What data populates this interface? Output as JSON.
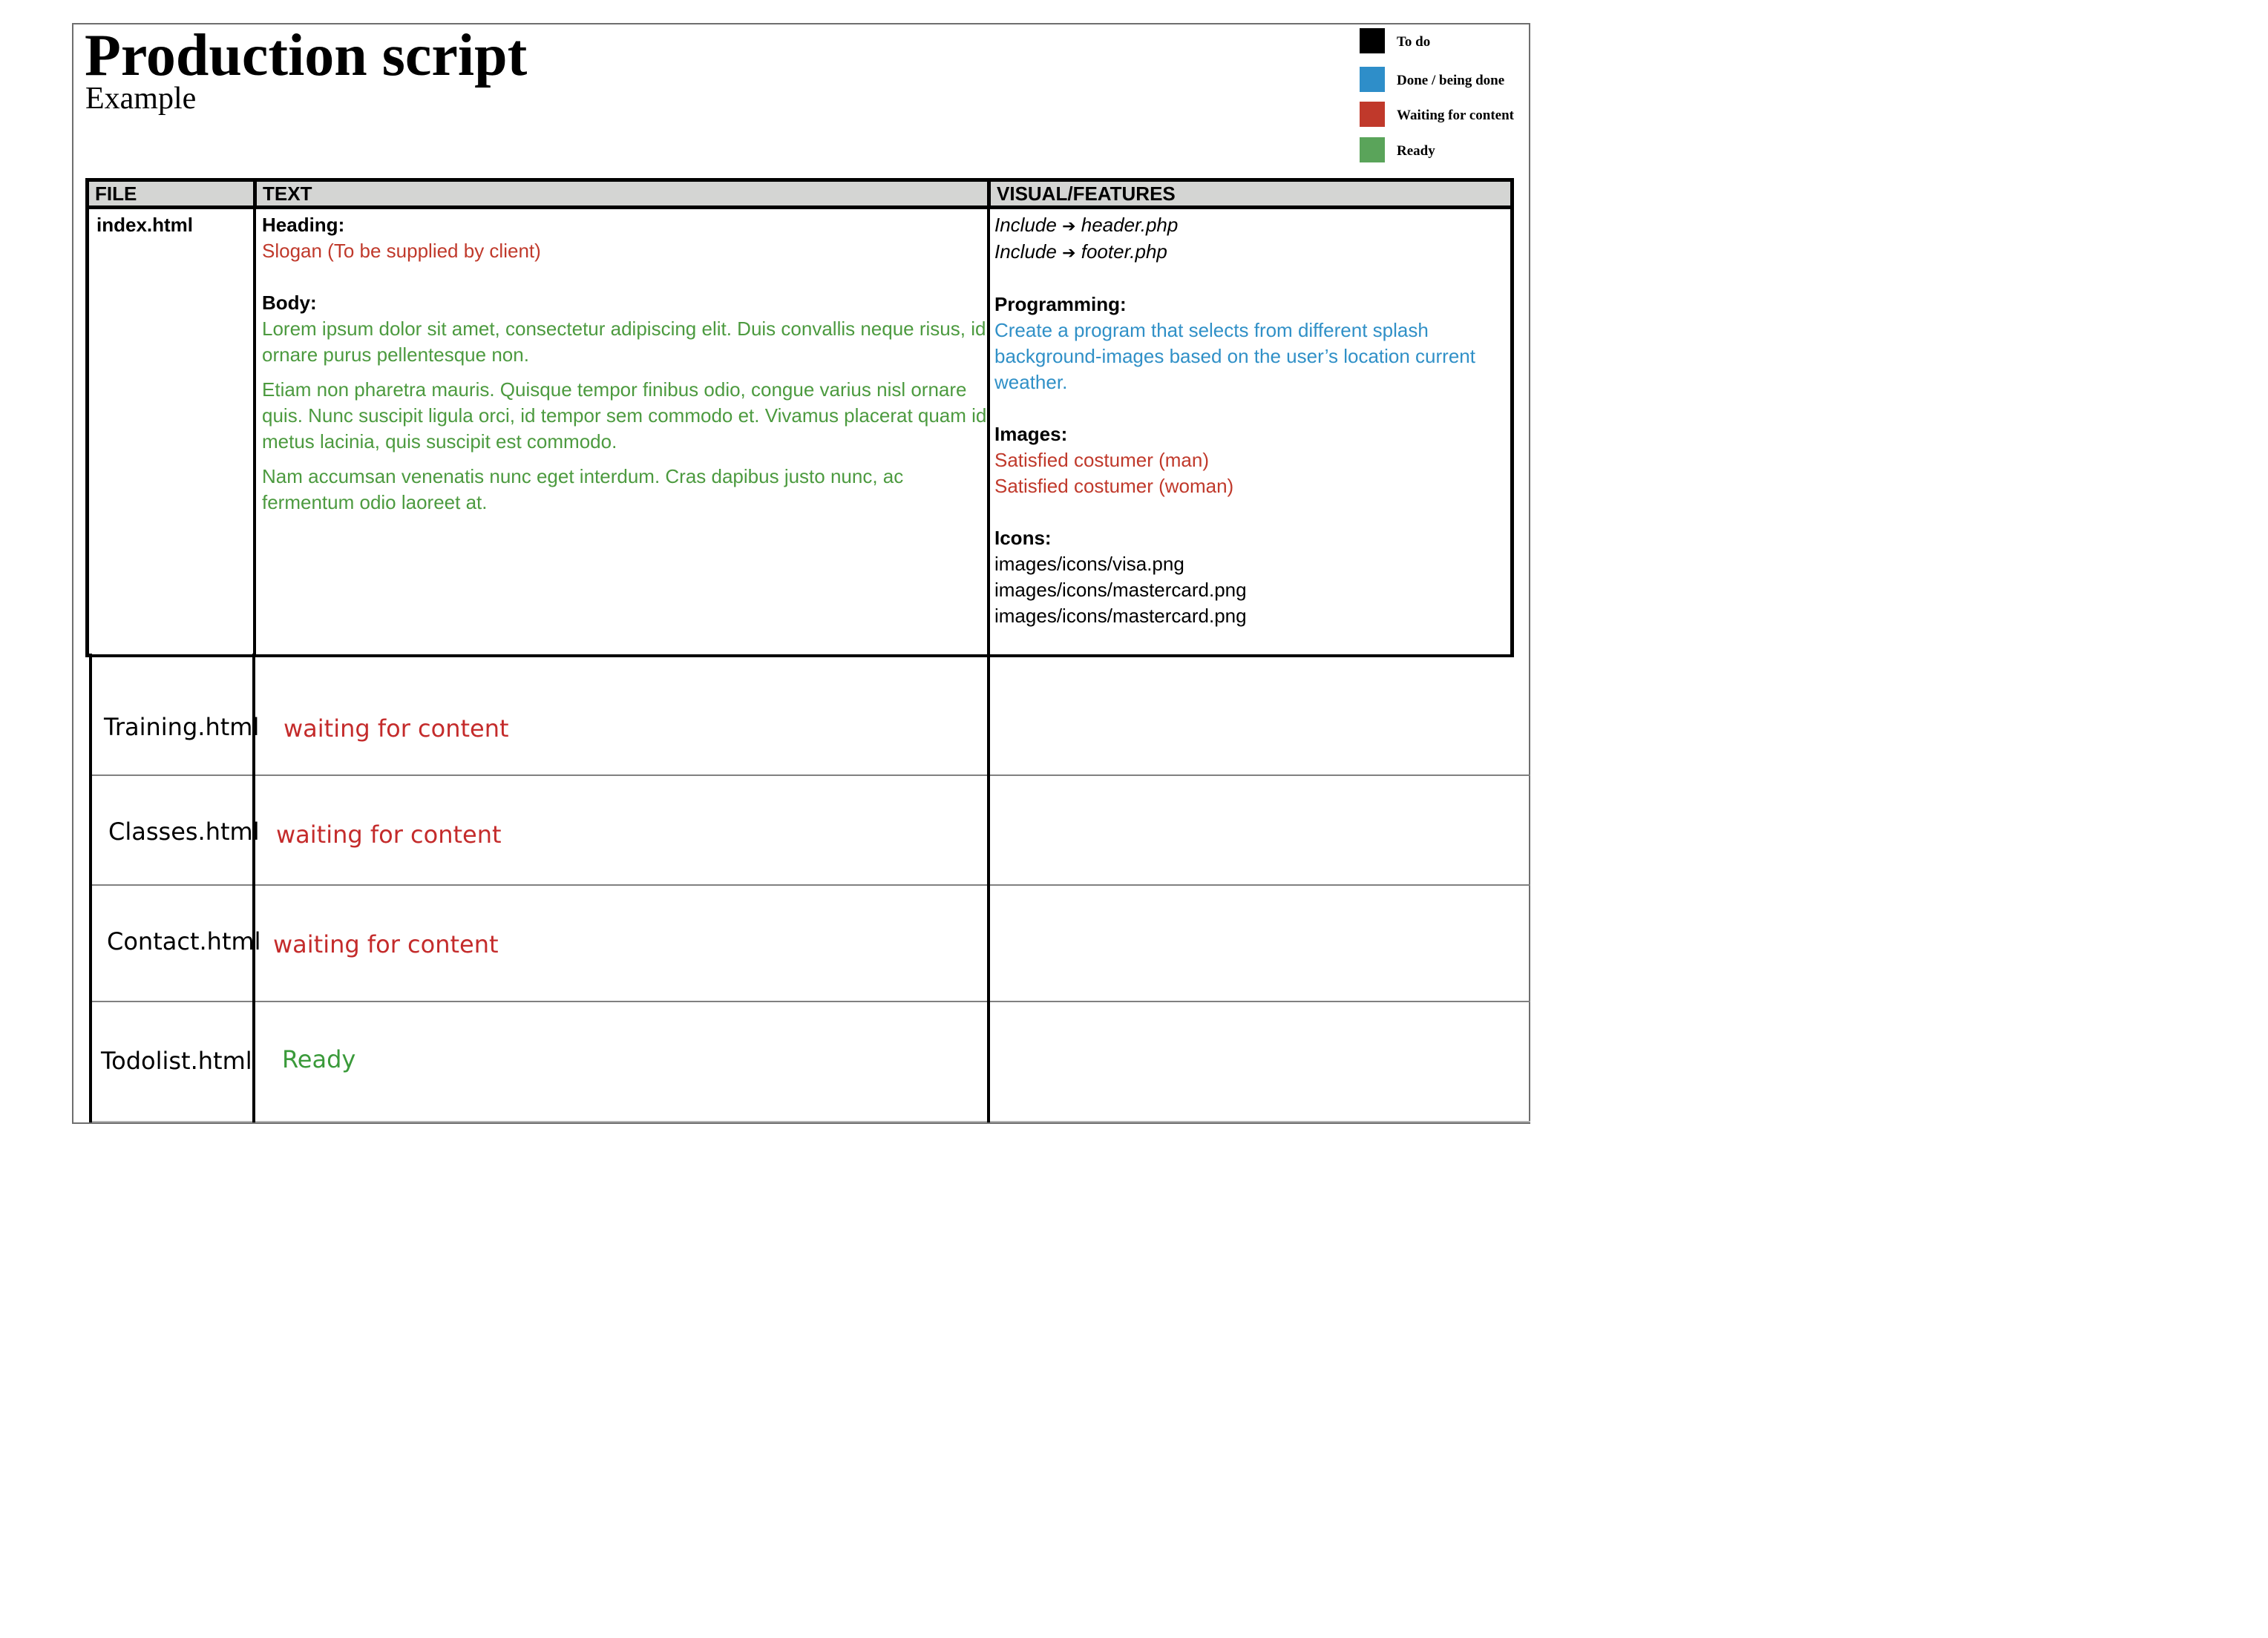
{
  "document": {
    "title": "Production script",
    "subtitle": "Example"
  },
  "legend": [
    {
      "label": "To do",
      "color": "#000000"
    },
    {
      "label": "Done / being done",
      "color": "#2e8ec9"
    },
    {
      "label": "Waiting for content",
      "color": "#c0392b"
    },
    {
      "label": "Ready",
      "color": "#5aa45a"
    }
  ],
  "table": {
    "headers": {
      "file": "FILE",
      "text": "TEXT",
      "visual": "VISUAL/FEATURES"
    },
    "index_row": {
      "file": "index.html",
      "text": {
        "heading_label": "Heading:",
        "heading_value": "Slogan (To be supplied by client)",
        "body_label": "Body:",
        "body_paragraphs": [
          "Lorem ipsum dolor sit amet, consectetur adipiscing elit. Duis convallis neque risus, id ornare purus pellentesque non.",
          "Etiam non pharetra mauris. Quisque tempor finibus odio, congue varius nisl ornare quis. Nunc suscipit ligula orci, id tempor sem commodo et. Vivamus placerat quam id metus lacinia, quis suscipit est commodo.",
          "Nam accumsan venenatis nunc eget interdum. Cras dapibus justo nunc, ac fermentum odio laoreet at."
        ]
      },
      "visual": {
        "includes": [
          {
            "word": "Include",
            "arrow": "➔",
            "file": "header.php"
          },
          {
            "word": "Include",
            "arrow": "➔",
            "file": "footer.php"
          }
        ],
        "programming_label": "Programming:",
        "programming_text": "Create a program that selects from different splash background-images based on the user’s location current weather.",
        "images_label": "Images:",
        "images": [
          "Satisfied costumer (man)",
          "Satisfied costumer (woman)"
        ],
        "icons_label": "Icons:",
        "icons": [
          "images/icons/visa.png",
          "images/icons/mastercard.png",
          "images/icons/mastercard.png"
        ]
      }
    },
    "other_rows": [
      {
        "file": "Training.html",
        "status": "waiting for content"
      },
      {
        "file": "Classes.html",
        "status": "waiting for content"
      },
      {
        "file": "Contact.html",
        "status": "waiting for content"
      },
      {
        "file": "Todolist.html",
        "status": "Ready"
      }
    ]
  }
}
